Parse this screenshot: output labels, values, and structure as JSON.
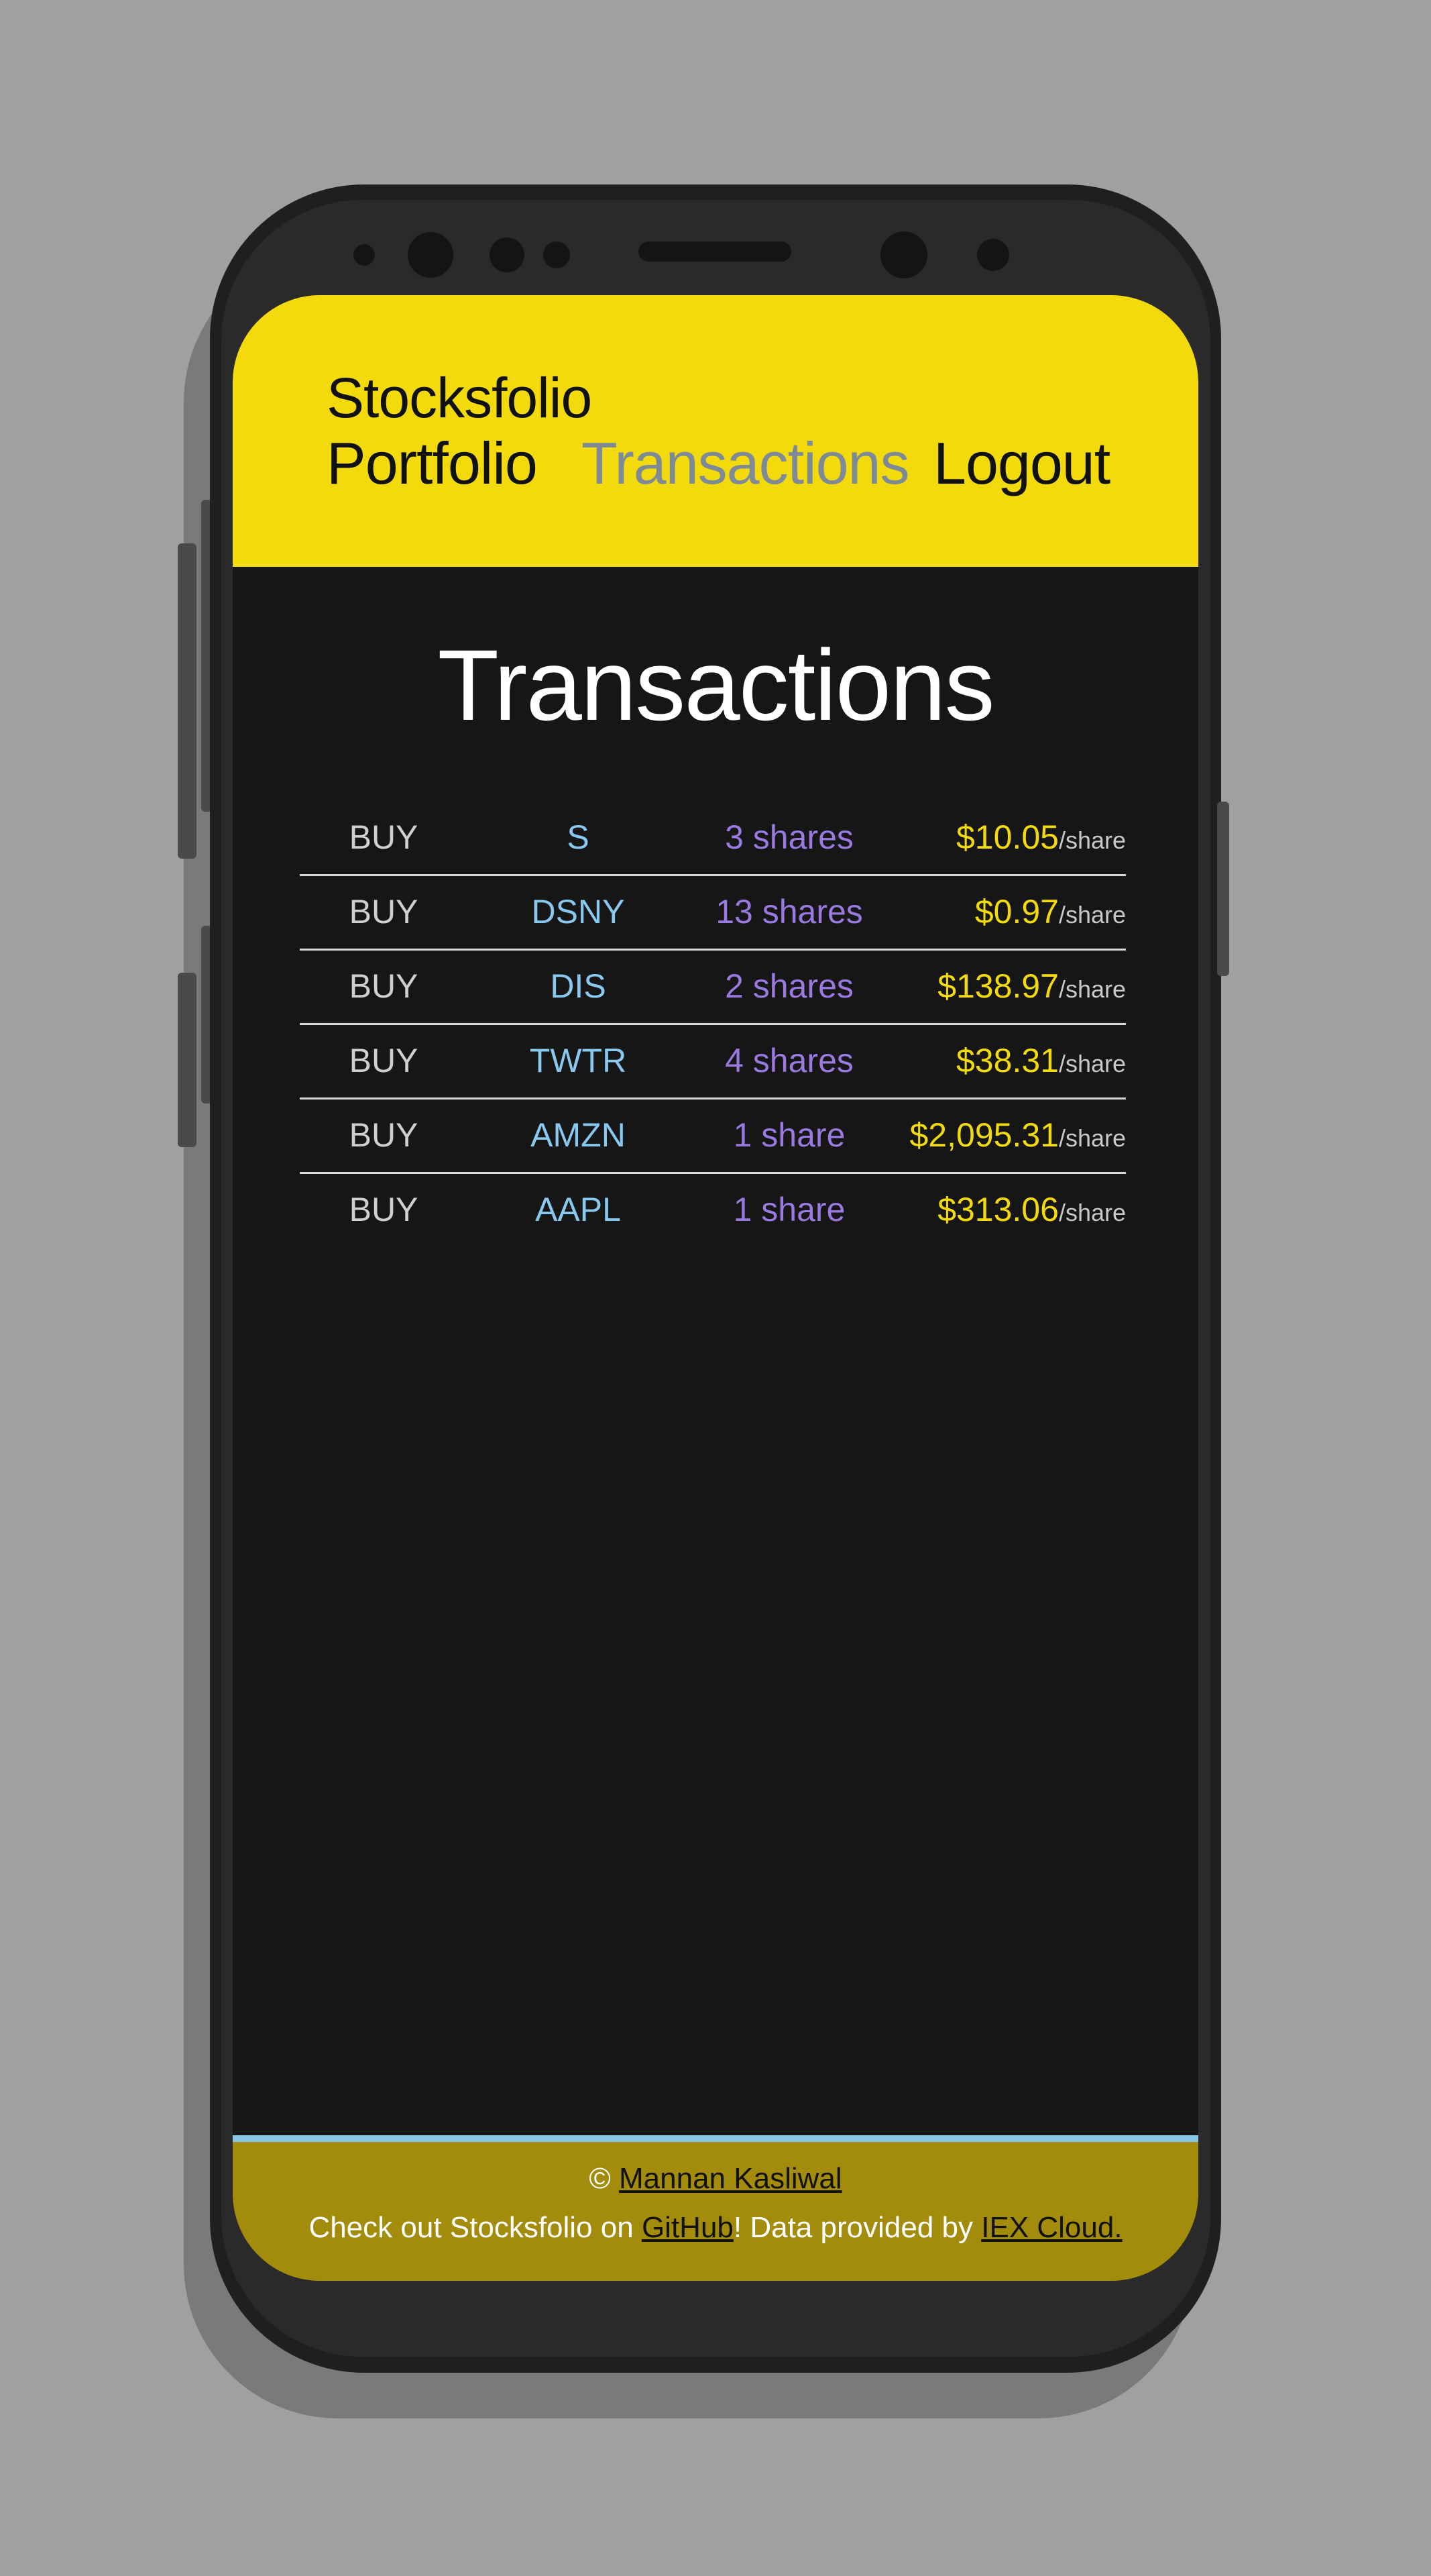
{
  "header": {
    "brand": "Stocksfolio",
    "nav": {
      "portfolio": "Portfolio",
      "transactions": "Transactions",
      "logout": "Logout"
    }
  },
  "main": {
    "title": "Transactions",
    "transactions": [
      {
        "type": "BUY",
        "symbol": "S",
        "quantity": "3 shares",
        "price": "$10.05",
        "unit": "/share"
      },
      {
        "type": "BUY",
        "symbol": "DSNY",
        "quantity": "13 shares",
        "price": "$0.97",
        "unit": "/share"
      },
      {
        "type": "BUY",
        "symbol": "DIS",
        "quantity": "2 shares",
        "price": "$138.97",
        "unit": "/share"
      },
      {
        "type": "BUY",
        "symbol": "TWTR",
        "quantity": "4 shares",
        "price": "$38.31",
        "unit": "/share"
      },
      {
        "type": "BUY",
        "symbol": "AMZN",
        "quantity": "1 share",
        "price": "$2,095.31",
        "unit": "/share"
      },
      {
        "type": "BUY",
        "symbol": "AAPL",
        "quantity": "1 share",
        "price": "$313.06",
        "unit": "/share"
      }
    ]
  },
  "footer": {
    "copyright_symbol": "©",
    "author": "Mannan Kasliwal",
    "text_prefix": "Check out Stocksfolio on",
    "github": "GitHub",
    "text_middle": "! Data provided by",
    "iex": "IEX Cloud."
  },
  "colors": {
    "header_bg": "#f2da0c",
    "screen_bg": "#161616",
    "footer_bg": "#a38c0b",
    "footer_accent": "#86c8e6",
    "symbol": "#89c9f0",
    "quantity": "#9a7ae0",
    "price": "#f2da0c",
    "nav_active": "#7e8a96"
  }
}
